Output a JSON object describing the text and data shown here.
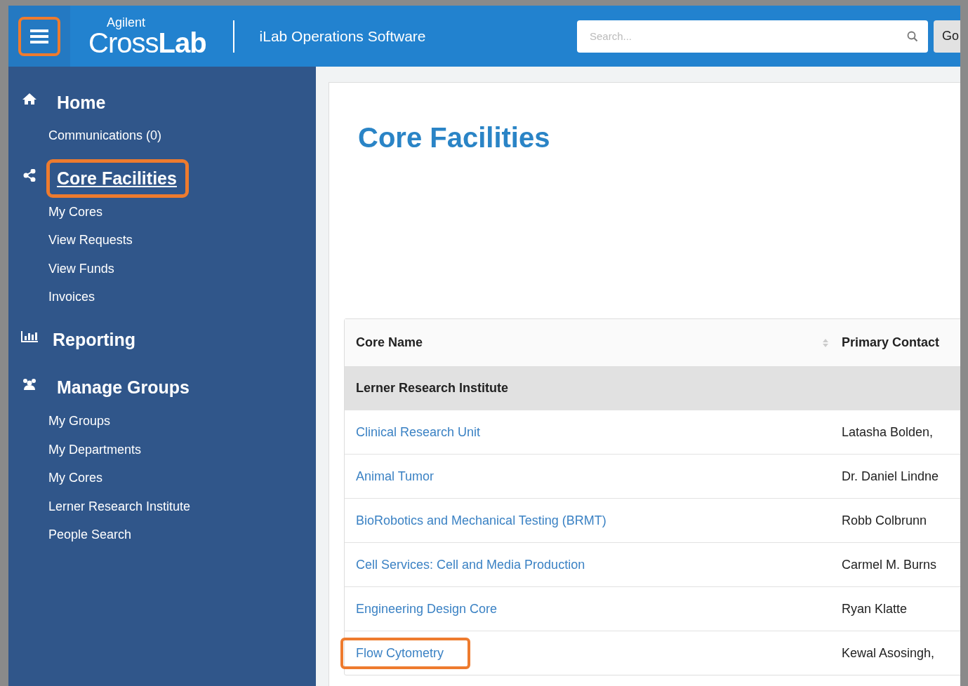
{
  "header": {
    "menu_highlighted": true,
    "logo_small": "Agilent",
    "logo_light": "Cross",
    "logo_bold": "Lab",
    "app_title": "iLab Operations Software",
    "search": {
      "placeholder": "Search..."
    },
    "go_button": "Go"
  },
  "sidebar": {
    "sections": [
      {
        "kind": "home",
        "label": "Home",
        "underlined": false,
        "highlighted": false,
        "items": [
          "Communications (0)"
        ]
      },
      {
        "kind": "share",
        "label": "Core Facilities",
        "underlined": true,
        "highlighted": true,
        "items": [
          "My Cores",
          "View Requests",
          "View Funds",
          "Invoices"
        ]
      },
      {
        "kind": "chart",
        "label": "Reporting",
        "underlined": false,
        "highlighted": false
      },
      {
        "kind": "group",
        "label": "Manage Groups",
        "underlined": false,
        "highlighted": false,
        "items": [
          "My Groups",
          "My Departments",
          "My Cores",
          "Lerner Research Institute",
          "People Search"
        ]
      }
    ]
  },
  "page": {
    "title": "Core Facilities"
  },
  "table": {
    "columns": [
      "Core Name",
      "Primary Contact"
    ],
    "group": "Lerner Research Institute",
    "rows": [
      {
        "name": "Clinical Research Unit",
        "contact": "Latasha Bolden,",
        "highlighted": false
      },
      {
        "name": "Animal Tumor",
        "contact": "Dr. Daniel Lindne",
        "highlighted": false
      },
      {
        "name": "BioRobotics and Mechanical Testing (BRMT)",
        "contact": "Robb Colbrunn",
        "highlighted": false
      },
      {
        "name": "Cell Services: Cell and Media Production",
        "contact": "Carmel M. Burns",
        "highlighted": false
      },
      {
        "name": "Engineering Design Core",
        "contact": "Ryan Klatte",
        "highlighted": false
      },
      {
        "name": "Flow Cytometry",
        "contact": "Kewal Asosingh,",
        "highlighted": true
      }
    ]
  }
}
